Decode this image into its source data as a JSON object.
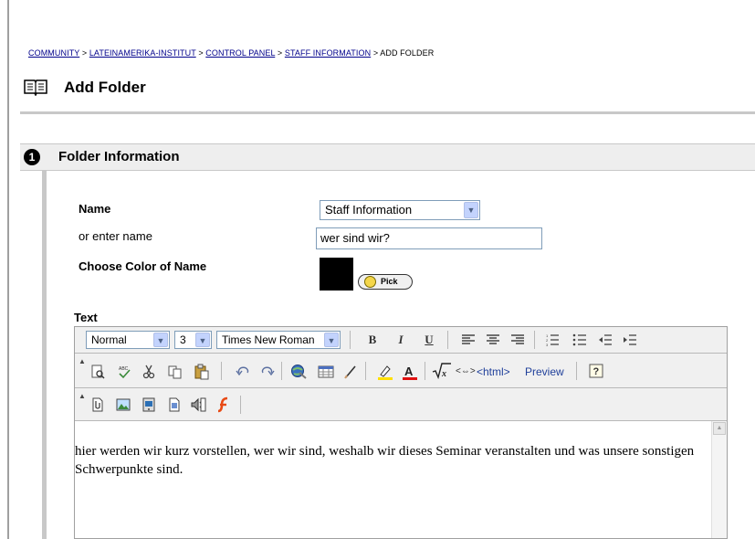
{
  "breadcrumb": {
    "items": [
      "COMMUNITY",
      "LATEINAMERIKA-INSTITUT",
      "CONTROL PANEL",
      "STAFF INFORMATION"
    ],
    "current": "ADD FOLDER",
    "separator": ">"
  },
  "page": {
    "title": "Add Folder",
    "icon": "book-icon"
  },
  "section": {
    "number": "1",
    "title": "Folder Information"
  },
  "form": {
    "name_label": "Name",
    "name_select_value": "Staff Information",
    "enter_name_label": "or enter name",
    "enter_name_value": "wer sind wir?",
    "color_label": "Choose Color of Name",
    "color_value": "#000000",
    "pick_label": "Pick",
    "text_label": "Text"
  },
  "editor": {
    "format_value": "Normal",
    "size_value": "3",
    "font_value": "Times New Roman",
    "bold": "B",
    "italic": "I",
    "underline": "U",
    "html_label": "<html>",
    "preview_label": "Preview",
    "content": "hier werden wir kurz vorstellen, wer wir sind, weshalb wir dieses Seminar veranstalten und was unsere sonstigen Schwerpunkte sind."
  }
}
